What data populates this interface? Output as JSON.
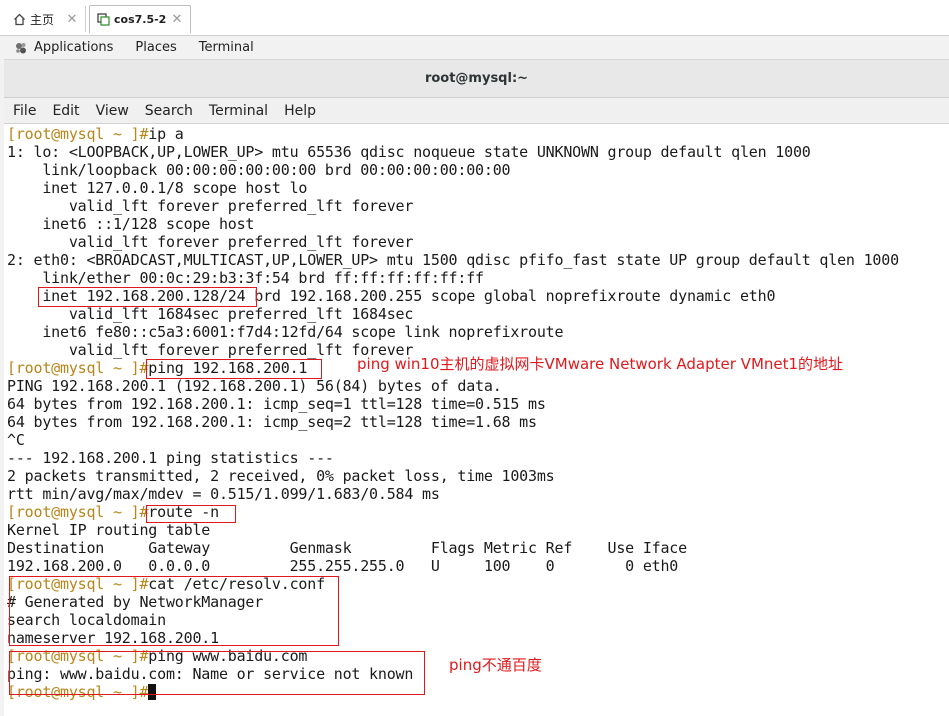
{
  "tabs": [
    {
      "label": "主页",
      "icon": "home-icon",
      "close": "✕"
    },
    {
      "label": "cos7.5-2",
      "icon": "vm-icon",
      "close": "✕"
    }
  ],
  "panel": {
    "apps": "Applications",
    "places": "Places",
    "terminal": "Terminal"
  },
  "window": {
    "title": "root@mysql:~"
  },
  "menu": [
    "File",
    "Edit",
    "View",
    "Search",
    "Terminal",
    "Help"
  ],
  "terminal": {
    "prompt": "[root@mysql ~ ]#",
    "lines": [
      {
        "p": true,
        "t": "ip a"
      },
      {
        "p": false,
        "t": "1: lo: <LOOPBACK,UP,LOWER_UP> mtu 65536 qdisc noqueue state UNKNOWN group default qlen 1000"
      },
      {
        "p": false,
        "t": "    link/loopback 00:00:00:00:00:00 brd 00:00:00:00:00:00"
      },
      {
        "p": false,
        "t": "    inet 127.0.0.1/8 scope host lo"
      },
      {
        "p": false,
        "t": "       valid_lft forever preferred_lft forever"
      },
      {
        "p": false,
        "t": "    inet6 ::1/128 scope host"
      },
      {
        "p": false,
        "t": "       valid_lft forever preferred_lft forever"
      },
      {
        "p": false,
        "t": "2: eth0: <BROADCAST,MULTICAST,UP,LOWER_UP> mtu 1500 qdisc pfifo_fast state UP group default qlen 1000"
      },
      {
        "p": false,
        "t": "    link/ether 00:0c:29:b3:3f:54 brd ff:ff:ff:ff:ff:ff"
      },
      {
        "p": false,
        "t": "    inet 192.168.200.128/24 brd 192.168.200.255 scope global noprefixroute dynamic eth0"
      },
      {
        "p": false,
        "t": "       valid_lft 1684sec preferred_lft 1684sec"
      },
      {
        "p": false,
        "t": "    inet6 fe80::c5a3:6001:f7d4:12fd/64 scope link noprefixroute"
      },
      {
        "p": false,
        "t": "       valid_lft forever preferred_lft forever"
      },
      {
        "p": true,
        "t": "ping 192.168.200.1"
      },
      {
        "p": false,
        "t": "PING 192.168.200.1 (192.168.200.1) 56(84) bytes of data."
      },
      {
        "p": false,
        "t": "64 bytes from 192.168.200.1: icmp_seq=1 ttl=128 time=0.515 ms"
      },
      {
        "p": false,
        "t": "64 bytes from 192.168.200.1: icmp_seq=2 ttl=128 time=1.68 ms"
      },
      {
        "p": false,
        "t": "^C"
      },
      {
        "p": false,
        "t": "--- 192.168.200.1 ping statistics ---"
      },
      {
        "p": false,
        "t": "2 packets transmitted, 2 received, 0% packet loss, time 1003ms"
      },
      {
        "p": false,
        "t": "rtt min/avg/max/mdev = 0.515/1.099/1.683/0.584 ms"
      },
      {
        "p": true,
        "t": "route -n"
      },
      {
        "p": false,
        "t": "Kernel IP routing table"
      },
      {
        "p": false,
        "t": "Destination     Gateway         Genmask         Flags Metric Ref    Use Iface"
      },
      {
        "p": false,
        "t": "192.168.200.0   0.0.0.0         255.255.255.0   U     100    0        0 eth0"
      },
      {
        "p": true,
        "t": "cat /etc/resolv.conf"
      },
      {
        "p": false,
        "t": "# Generated by NetworkManager"
      },
      {
        "p": false,
        "t": "search localdomain"
      },
      {
        "p": false,
        "t": "nameserver 192.168.200.1"
      },
      {
        "p": true,
        "t": "ping www.baidu.com"
      },
      {
        "p": false,
        "t": "ping: www.baidu.com: Name or service not known"
      },
      {
        "p": true,
        "t": "",
        "cursor": true
      }
    ]
  },
  "annotations": {
    "ping_gateway": "ping win10主机的虚拟网卡VMware Network Adapter VMnet1的地址",
    "ping_baidu": "ping不通百度"
  },
  "colors": {
    "prompt": "#b8861b",
    "annotation": "#e0191d",
    "text": "#1a1a1a"
  }
}
